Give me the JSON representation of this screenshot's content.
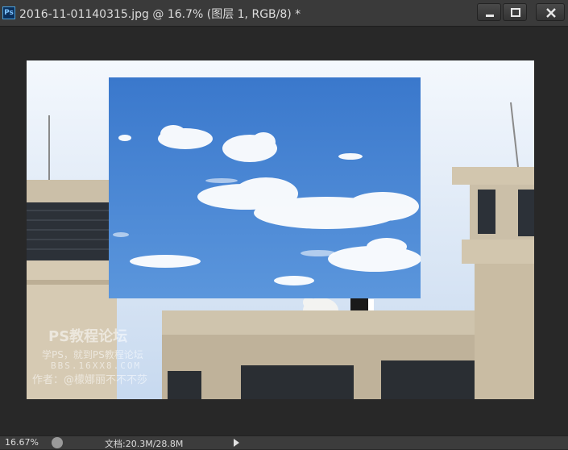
{
  "window": {
    "app_icon": "Ps",
    "title": "2016-11-01140315.jpg @ 16.7% (图层 1, RGB/8) *",
    "buttons": [
      "minimize-icon",
      "maximize-icon",
      "close-icon"
    ]
  },
  "canvas": {
    "watermark": {
      "line1": "PS教程论坛",
      "line2": "学PS，就到PS教程论坛",
      "line3": "BBS.16XX8.COM",
      "line4": "作者：@檬娜丽不不不莎"
    }
  },
  "statusbar": {
    "zoom": "16.67%",
    "doc_info": "文档:20.3M/28.8M"
  },
  "colors": {
    "chrome": "#3a3a3a",
    "workspace": "#282828",
    "sky": "#4a86d4"
  }
}
